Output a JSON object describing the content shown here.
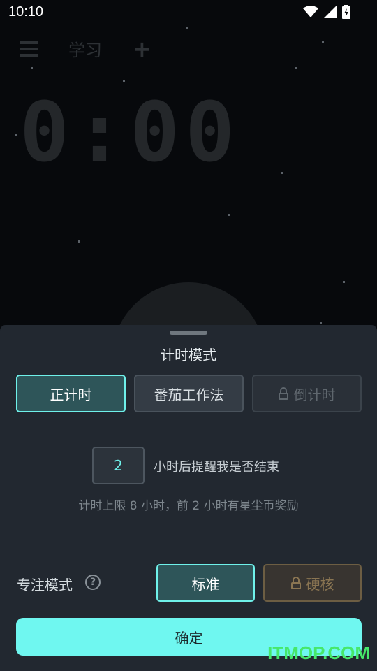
{
  "status_bar": {
    "time": "10:10"
  },
  "toolbar": {
    "task_label": "学习"
  },
  "timer": {
    "display": "0:00"
  },
  "sheet": {
    "title": "计时模式",
    "modes": [
      "正计时",
      "番茄工作法",
      "倒计时"
    ],
    "reminder": {
      "hours_value": "2",
      "suffix": "小时后提醒我是否结束"
    },
    "limit_note": "计时上限 8 小时，前 2 小时有星尘币奖励",
    "focus": {
      "label": "专注模式",
      "help": "?",
      "standard": "标准",
      "hardcore": "硬核"
    },
    "confirm": "确定"
  },
  "watermark": "ITMOP.COM",
  "colors": {
    "accent": "#6ff1ea",
    "sheet_bg": "#222830",
    "confirm_bg": "#6ff7f0"
  }
}
